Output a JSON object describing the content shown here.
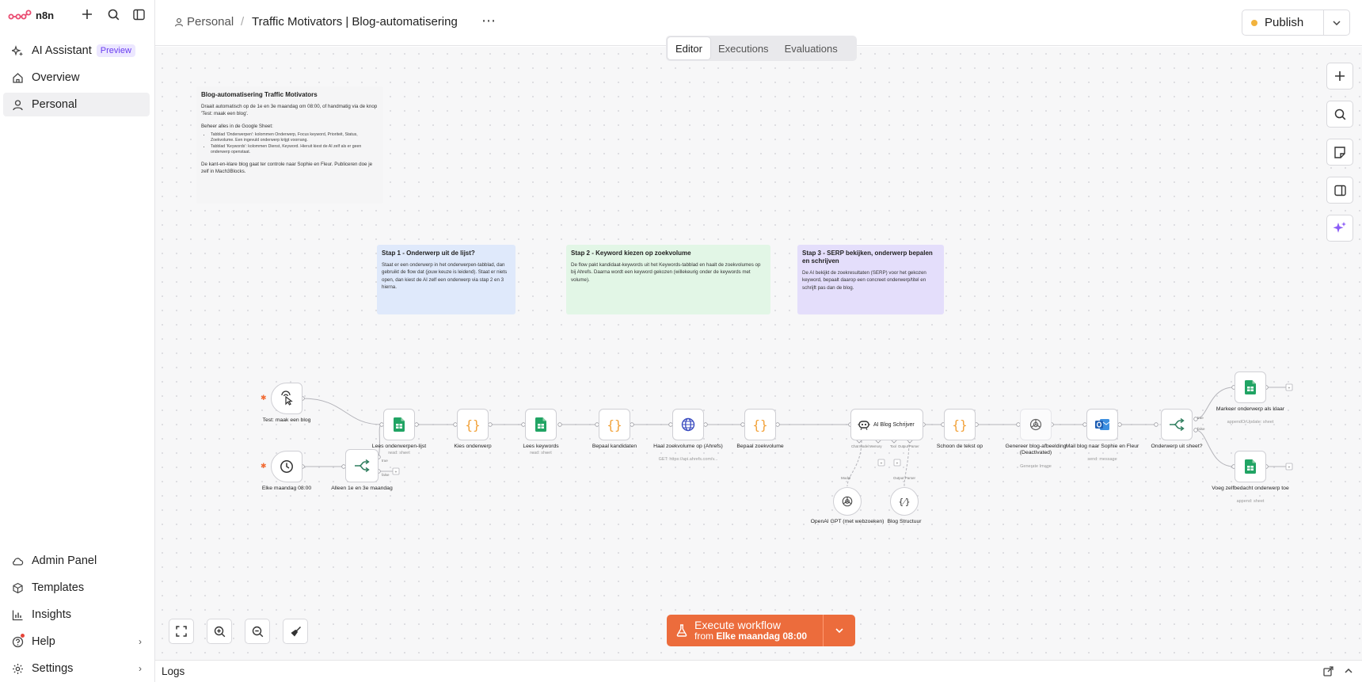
{
  "app": {
    "name": "n8n"
  },
  "sidebar": {
    "top": [
      {
        "label": "AI Assistant",
        "badge": "Preview",
        "icon": "sparkle-icon"
      },
      {
        "label": "Overview",
        "icon": "home-icon"
      },
      {
        "label": "Personal",
        "icon": "user-icon",
        "active": true
      }
    ],
    "bottom": [
      {
        "label": "Admin Panel",
        "icon": "cloud-icon"
      },
      {
        "label": "Templates",
        "icon": "box-icon"
      },
      {
        "label": "Insights",
        "icon": "bar-chart-icon"
      },
      {
        "label": "Help",
        "icon": "help-icon",
        "has_dot": true
      },
      {
        "label": "Settings",
        "icon": "gear-icon"
      }
    ]
  },
  "header": {
    "breadcrumb_home": "Personal",
    "breadcrumb_sep": "/",
    "title": "Traffic Motivators | Blog-automatisering",
    "more": "⋯",
    "publish": "Publish"
  },
  "tabs": [
    "Editor",
    "Executions",
    "Evaluations"
  ],
  "stickies": {
    "main": {
      "title": "Blog-automatisering Traffic Motivators",
      "p1": "Draait automatisch op de 1e en 3e maandag om 08:00, of handmatig via de knop 'Test: maak een blog'.",
      "p2": "Beheer alles in de Google Sheet:",
      "li1": "Tabblad 'Onderwerpen': kolommen Onderwerp, Focus keyword, Prioriteit, Status, Zoekvolume. Een ingevuld onderwerp krijgt voorrang.",
      "li2": "Tabblad 'Keywords': kolommen Dienst, Keyword. Hieruit kiest de AI zelf als er geen onderwerp openstaat.",
      "p3": "De kant-en-klare blog gaat ter controle naar Sophie en Fleur. Publiceren doe je zelf in Mach3Blocks."
    },
    "step1": {
      "title": "Stap 1 - Onderwerp uit de lijst?",
      "text": "Staat er een onderwerp in het onderwerpen-tabblad, dan gebruikt de flow dat (jouw keuze is leidend). Staat er niets open, dan kiest de AI zelf een onderwerp via stap 2 en 3 hierna."
    },
    "step2": {
      "title": "Stap 2 - Keyword kiezen op zoekvolume",
      "text": "De flow pakt kandidaat-keywords uit het Keywords-tabblad en haalt de zoekvolumes op bij Ahrefs. Daarna wordt een keyword gekozen (willekeurig onder de keywords met volume)."
    },
    "step3": {
      "title": "Stap 3 - SERP bekijken, onderwerp bepalen en schrijven",
      "text": "De AI bekijkt de zoekresultaten (SERP) voor het gekozen keyword, bepaalt daarop een concreet onderwerp/titel en schrijft pas dan de blog."
    }
  },
  "nodes": {
    "test": {
      "label": "Test: maak een blog"
    },
    "cron": {
      "label": "Elke maandag 08:00"
    },
    "if1": {
      "label": "Alleen 1e en 3e maandag",
      "true": "true",
      "false": "false"
    },
    "read_subjects": {
      "label": "Lees onderwerpen-lijst",
      "sub": "read: sheet"
    },
    "pick_subject": {
      "label": "Kies onderwerp"
    },
    "read_keywords": {
      "label": "Lees keywords",
      "sub": "read: sheet"
    },
    "candidates": {
      "label": "Bepaal kandidaten"
    },
    "ahrefs": {
      "label": "Haal zoekvolume op (Ahrefs)",
      "sub": "GET: https://api.ahrefs.com/v..."
    },
    "volume": {
      "label": "Bepaal zoekvolume"
    },
    "agent": {
      "label": "AI Blog Schrijver",
      "port1": "Chat Model",
      "port2": "Memory",
      "port3": "Tool",
      "port4": "Output Parser"
    },
    "clean": {
      "label": "Schoon de tekst op"
    },
    "image": {
      "label": "Genereer blog-afbeelding (Deactivated)",
      "sub": "Generate Image"
    },
    "mail": {
      "label": "Mail blog naar Sophie en Fleur",
      "sub": "send: message"
    },
    "from_sheet": {
      "label": "Onderwerp uit sheet?",
      "true": "true",
      "false": "false"
    },
    "mark_done": {
      "label": "Markeer onderwerp als klaar",
      "sub": "appendOrUpdate: sheet"
    },
    "add_own": {
      "label": "Voeg zelfbedacht onderwerp toe",
      "sub": "append: sheet"
    },
    "openai": {
      "label": "OpenAI GPT (met webzoeken)",
      "port": "Model"
    },
    "structure": {
      "label": "Blog Structuur",
      "port": "Output Parser"
    }
  },
  "execute": {
    "title": "Execute workflow",
    "from": "from",
    "trigger": "Elke maandag 08:00"
  },
  "logs": {
    "label": "Logs"
  },
  "colors": {
    "accent": "#ec6c3c",
    "sheets_green": "#21a464",
    "code_orange": "#f2a23a",
    "step1_bg": "#dfe9fb",
    "step2_bg": "#e2f6e6",
    "step3_bg": "#e4defb"
  }
}
